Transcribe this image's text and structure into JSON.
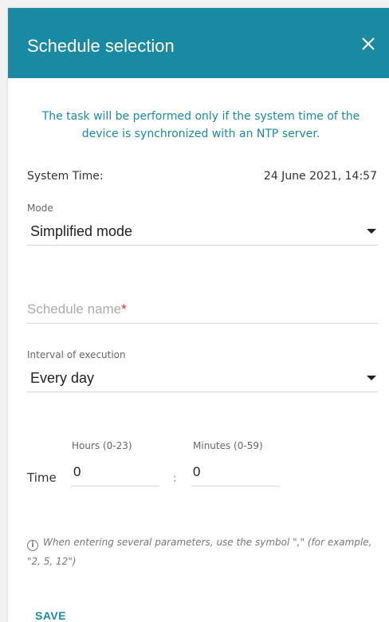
{
  "dialog": {
    "title": "Schedule selection",
    "close_icon": "close-icon",
    "accent_color": "#1a8aa3"
  },
  "notice": "The task will be performed only if the system time of the device is synchronized with an NTP server.",
  "system_time": {
    "label": "System Time:",
    "value": "24 June 2021, 14:57"
  },
  "mode": {
    "label": "Mode",
    "value": "Simplified mode"
  },
  "schedule_name": {
    "placeholder": "Schedule name",
    "required_mark": "*"
  },
  "interval": {
    "label": "Interval of execution",
    "value": "Every day"
  },
  "time": {
    "label": "Time",
    "hours_label": "Hours (0-23)",
    "hours_value": "0",
    "separator": ":",
    "minutes_label": "Minutes (0-59)",
    "minutes_value": "0"
  },
  "info": {
    "icon": "info-icon",
    "icon_glyph": "i",
    "text": "When entering several parameters, use the symbol \",\" (for example, \"2, 5, 12\")"
  },
  "actions": {
    "save_label": "SAVE"
  }
}
